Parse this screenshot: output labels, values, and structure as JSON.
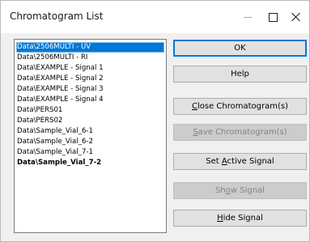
{
  "window": {
    "title": "Chromatogram List"
  },
  "list": {
    "items": [
      {
        "label": "Data\\2506MULTI - UV",
        "selected": true,
        "bold": false
      },
      {
        "label": "Data\\2506MULTI - RI",
        "selected": false,
        "bold": false
      },
      {
        "label": "Data\\EXAMPLE - Signal 1",
        "selected": false,
        "bold": false
      },
      {
        "label": "Data\\EXAMPLE - Signal 2",
        "selected": false,
        "bold": false
      },
      {
        "label": "Data\\EXAMPLE - Signal 3",
        "selected": false,
        "bold": false
      },
      {
        "label": "Data\\EXAMPLE - Signal 4",
        "selected": false,
        "bold": false
      },
      {
        "label": "Data\\PERS01",
        "selected": false,
        "bold": false
      },
      {
        "label": "Data\\PERS02",
        "selected": false,
        "bold": false
      },
      {
        "label": "Data\\Sample_Vial_6-1",
        "selected": false,
        "bold": false
      },
      {
        "label": "Data\\Sample_Vial_6-2",
        "selected": false,
        "bold": false
      },
      {
        "label": "Data\\Sample_Vial_7-1",
        "selected": false,
        "bold": false
      },
      {
        "label": "Data\\Sample_Vial_7-2",
        "selected": false,
        "bold": true
      }
    ]
  },
  "buttons": {
    "ok": {
      "label": "OK",
      "enabled": true,
      "default": true
    },
    "help": {
      "label": "Help",
      "enabled": true
    },
    "close_chromatogram": {
      "pre": "",
      "mnemonic": "C",
      "post": "lose Chromatogram(s)",
      "enabled": true
    },
    "save_chromatogram": {
      "pre": "",
      "mnemonic": "S",
      "post": "ave Chromatogram(s)",
      "enabled": false
    },
    "set_active_signal": {
      "pre": "Set ",
      "mnemonic": "A",
      "post": "ctive Signal",
      "enabled": true
    },
    "show_signal": {
      "pre": "Sh",
      "mnemonic": "o",
      "post": "w Signal",
      "enabled": false
    },
    "hide_signal": {
      "pre": "",
      "mnemonic": "H",
      "post": "ide Signal",
      "enabled": true
    }
  },
  "icons": {
    "minimize": "minimize-icon",
    "maximize": "maximize-icon",
    "close": "close-icon"
  },
  "colors": {
    "selection": "#0078d7",
    "default_button_border": "#0078d7",
    "disabled_text": "#838383"
  }
}
